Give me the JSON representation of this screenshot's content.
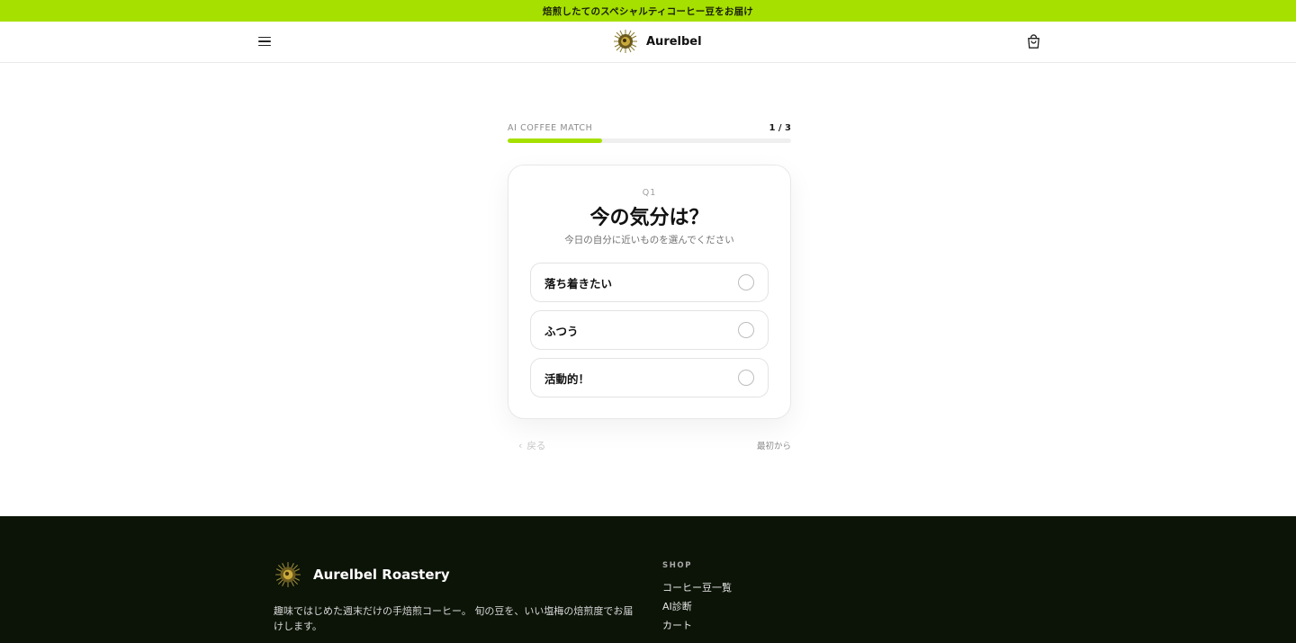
{
  "announcement": "焙煎したてのスペシャルティコーヒー豆をお届け",
  "header": {
    "brand_name": "Aurelbel"
  },
  "quiz": {
    "title": "AI COFFEE MATCH",
    "step": "1 / 3",
    "progress": 0.3333,
    "question_number": "Q1",
    "question": "今の気分は？",
    "subtitle": "今日の自分に近いものを選んでください",
    "options": [
      {
        "label": "落ち着きたい"
      },
      {
        "label": "ふつう"
      },
      {
        "label": "活動的！"
      }
    ],
    "back_label": "戻る",
    "restart_label": "最初から"
  },
  "footer": {
    "brand_name": "Aurelbel Roastery",
    "description": "趣味ではじめた週末だけの手焙煎コーヒー。 旬の豆を、いい塩梅の焙煎度でお届けします。",
    "shop_title": "SHOP",
    "links": [
      {
        "label": "コーヒー豆一覧"
      },
      {
        "label": "AI診断"
      },
      {
        "label": "カート"
      }
    ]
  },
  "colors": {
    "accent": "#a6e000",
    "footer_bg": "#0c1407"
  }
}
